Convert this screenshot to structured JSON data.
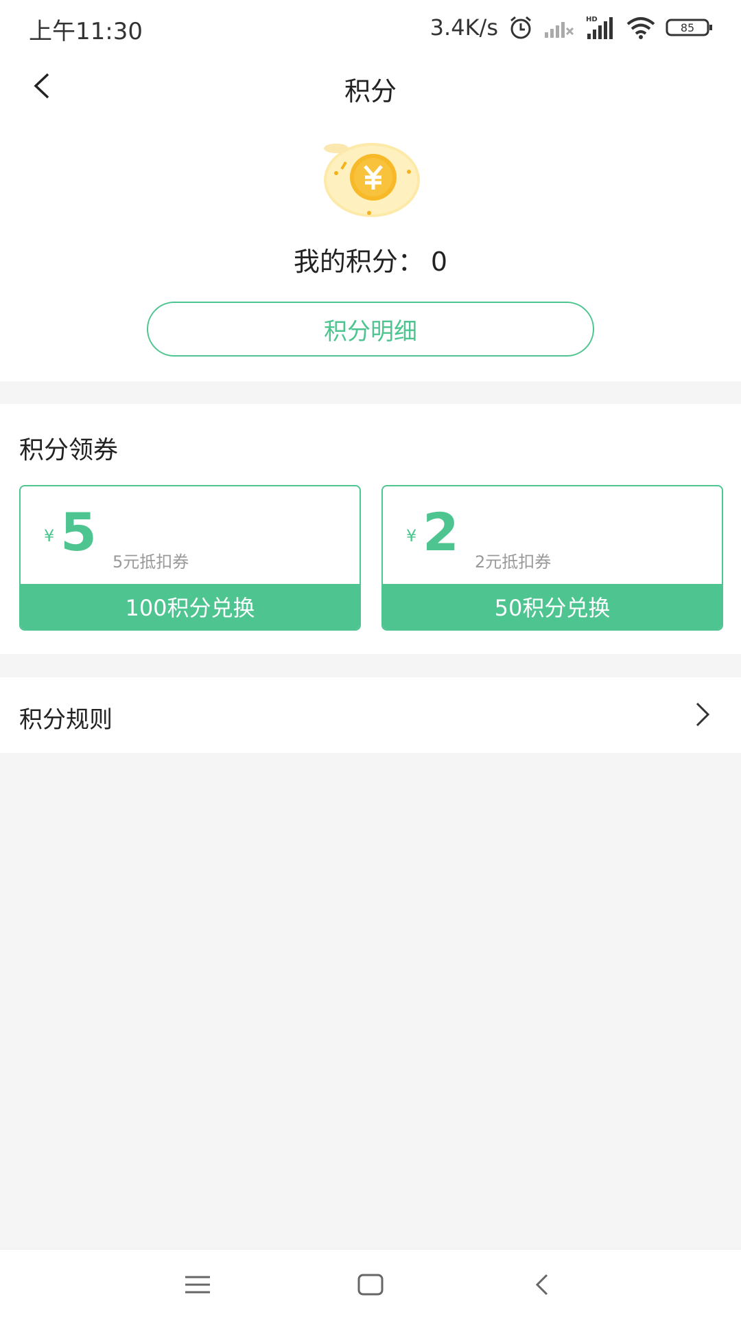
{
  "status_bar": {
    "time": "上午11:30",
    "speed": "3.4K/s",
    "battery": "85"
  },
  "header": {
    "title": "积分"
  },
  "points": {
    "label": "我的积分：",
    "value": "0",
    "detail_button": "积分明细"
  },
  "coupons": {
    "section_title": "积分领券",
    "items": [
      {
        "currency": "¥",
        "amount": "5",
        "description": "5元抵扣券",
        "exchange_label": "100积分兑换"
      },
      {
        "currency": "¥",
        "amount": "2",
        "description": "2元抵扣券",
        "exchange_label": "50积分兑换"
      }
    ]
  },
  "rules": {
    "label": "积分规则"
  },
  "colors": {
    "accent": "#4ec590",
    "background": "#f5f5f5"
  }
}
